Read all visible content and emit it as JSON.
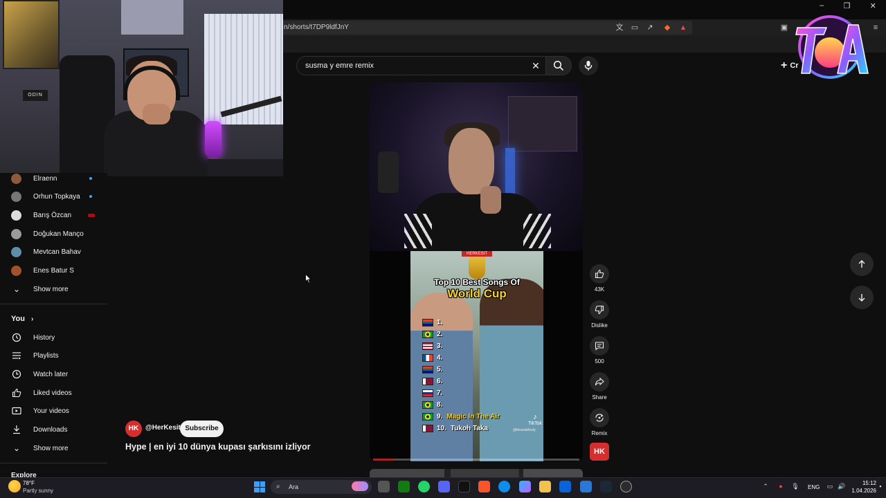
{
  "browser": {
    "url": "n/shorts/t7DP9ldfJnY"
  },
  "search": {
    "query": "susma y emre remix"
  },
  "header": {
    "create_label": "Cr"
  },
  "webcam": {
    "sign_text": "ODIN"
  },
  "sidebar": {
    "subscriptions": [
      {
        "name": "Elraenn",
        "indicator": "dot"
      },
      {
        "name": "Orhun Topkaya",
        "indicator": "dot"
      },
      {
        "name": "Barış Özcan",
        "indicator": "live"
      },
      {
        "name": "Doğukan Manço",
        "indicator": ""
      },
      {
        "name": "Mevtcan Bahav",
        "indicator": ""
      },
      {
        "name": "Enes Batur S",
        "indicator": ""
      }
    ],
    "subs_show_more": "Show more",
    "you_label": "You",
    "you_items": [
      {
        "label": "History",
        "icon": "history-icon"
      },
      {
        "label": "Playlists",
        "icon": "playlists-icon"
      },
      {
        "label": "Watch later",
        "icon": "watch-later-icon"
      },
      {
        "label": "Liked videos",
        "icon": "thumbs-up-icon"
      },
      {
        "label": "Your videos",
        "icon": "your-videos-icon"
      },
      {
        "label": "Downloads",
        "icon": "download-icon"
      }
    ],
    "you_show_more": "Show more",
    "explore_label": "Explore"
  },
  "short": {
    "clip_badge": "HERKESİT",
    "clip_title_line1": "Top 10 Best Songs Of",
    "clip_title_line2": "World Cup",
    "ranking": [
      {
        "num": "1.",
        "song": "",
        "flag": "south-africa"
      },
      {
        "num": "2.",
        "song": "",
        "flag": "brazil"
      },
      {
        "num": "3.",
        "song": "",
        "flag": "usa"
      },
      {
        "num": "4.",
        "song": "",
        "flag": "france"
      },
      {
        "num": "5.",
        "song": "",
        "flag": "south-africa"
      },
      {
        "num": "6.",
        "song": "",
        "flag": "qatar"
      },
      {
        "num": "7.",
        "song": "",
        "flag": "russia"
      },
      {
        "num": "8.",
        "song": "",
        "flag": "brazil"
      },
      {
        "num": "9.",
        "song": "Magic In The Air",
        "flag": "brazil"
      },
      {
        "num": "10.",
        "song": "Tukoh Taka",
        "flag": "qatar"
      }
    ],
    "tiktok_label": "TikTok",
    "tiktok_handle": "@thearabfooty",
    "progress_fraction": 0.1,
    "channel_handle": "@HerKesit",
    "channel_initials": "HK",
    "subscribe_label": "Subscribe",
    "title": "Hype | en iyi 10 dünya kupası şarkısını izliyor"
  },
  "actions": {
    "like_count": "43K",
    "dislike_label": "Dislike",
    "comments_count": "500",
    "share_label": "Share",
    "remix_label": "Remix"
  },
  "taskbar": {
    "temperature": "78°F",
    "weather": "Partly sunny",
    "search_placeholder": "Ara",
    "language": "ENG",
    "time": "15:12",
    "date": "1.04.2026"
  },
  "colors": {
    "accent_red": "#ff0000",
    "background": "#0f0f0f",
    "brand_channel": "#d32f2f"
  }
}
